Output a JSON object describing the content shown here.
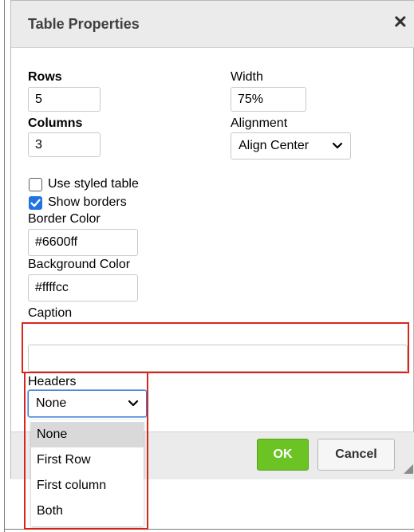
{
  "dialog": {
    "title": "Table Properties",
    "close_symbol": "✕"
  },
  "form": {
    "rows_label": "Rows",
    "rows_value": "5",
    "columns_label": "Columns",
    "columns_value": "3",
    "width_label": "Width",
    "width_value": "75%",
    "alignment_label": "Alignment",
    "alignment_value": "Align Center",
    "use_styled_table_label": "Use styled table",
    "use_styled_table_checked": false,
    "show_borders_label": "Show borders",
    "show_borders_checked": true,
    "border_color_label": "Border Color",
    "border_color_value": "#6600ff",
    "background_color_label": "Background Color",
    "background_color_value": "#ffffcc",
    "caption_label": "Caption",
    "caption_value": "",
    "headers_label": "Headers",
    "headers_value": "None"
  },
  "headers_dropdown": {
    "options": [
      "None",
      "First Row",
      "First column",
      "Both"
    ],
    "selected": "None"
  },
  "footer": {
    "ok_label": "OK",
    "cancel_label": "Cancel"
  },
  "colors": {
    "ok_button": "#6cc324",
    "checkbox_checked": "#1f74e0",
    "highlight_box": "#d9261c"
  },
  "icons": {
    "close": "close-icon",
    "dropdown": "chevron-down-icon",
    "checkmark": "checkmark-icon",
    "resize": "resize-grip-icon"
  }
}
